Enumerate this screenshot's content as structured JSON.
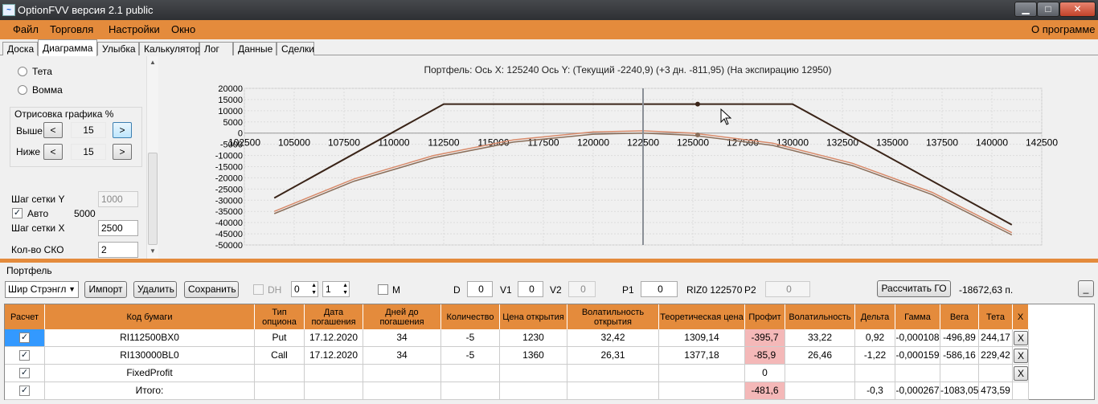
{
  "window": {
    "title": "OptionFVV версия 2.1 public",
    "minimize": "▁",
    "maximize": "□",
    "close": "✕",
    "icon": "chart-icon"
  },
  "menu": {
    "file": "Файл",
    "trading": "Торговля",
    "settings": "Настройки",
    "window": "Окно",
    "about": "О программе"
  },
  "tabs": [
    "Доска",
    "Диаграмма",
    "Улыбка",
    "Калькулятор",
    "Лог",
    "Данные",
    "Сделки"
  ],
  "left": {
    "theta": "Тета",
    "vomma": "Вомма",
    "group_title": "Отрисовка графика %",
    "above_label": "Выше",
    "above_value": "15",
    "below_label": "Ниже",
    "below_value": "15",
    "prev": "<",
    "next": ">",
    "grid_y_label": "Шаг сетки Y",
    "grid_y_value": "1000",
    "auto_label": "Авто",
    "auto_value": "5000",
    "grid_x_label": "Шаг сетки X",
    "grid_x_value": "2500",
    "sko_label": "Кол-во СКО",
    "sko_value": "2"
  },
  "chart_data": {
    "type": "line",
    "title": "Портфель: Ось X:  125240 Ось Y:   (Текущий -2240,9)   (+3 дн. -811,95)   (На экспирацию 12950)",
    "xlim": [
      102500,
      142500
    ],
    "ylim": [
      -50000,
      20000
    ],
    "x_ticks": [
      "102500",
      "105000",
      "107500",
      "110000",
      "112500",
      "115000",
      "117500",
      "120000",
      "122500",
      "125000",
      "127500",
      "130000",
      "132500",
      "135000",
      "137500",
      "140000",
      "142500"
    ],
    "y_ticks": [
      "20000",
      "15000",
      "10000",
      "5000",
      "0",
      "-5000",
      "-10000",
      "-15000",
      "-20000",
      "-25000",
      "-30000",
      "-35000",
      "-40000",
      "-45000",
      "-50000"
    ],
    "grid": true,
    "current_x": 122500,
    "cursor_x": 125240,
    "series": [
      {
        "color": "#3a2418",
        "x": [
          104000,
          112500,
          130000,
          141000
        ],
        "y": [
          -29000,
          12950,
          12950,
          -41000
        ]
      },
      {
        "color": "#d88a6a",
        "x": [
          104000,
          108000,
          112000,
          116000,
          120000,
          122500,
          125000,
          129000,
          133000,
          137000,
          141000
        ],
        "y": [
          -35000,
          -20500,
          -10000,
          -3000,
          500,
          1000,
          0,
          -4500,
          -13500,
          -26500,
          -44500
        ]
      },
      {
        "color": "#8a6e5a",
        "x": [
          104000,
          108000,
          112000,
          116000,
          120000,
          122500,
          125000,
          129000,
          133000,
          137000,
          141000
        ],
        "y": [
          -36000,
          -21500,
          -11000,
          -4000,
          -500,
          0,
          -1000,
          -5500,
          -14500,
          -27500,
          -45500
        ]
      }
    ]
  },
  "portfolio": {
    "label": "Портфель",
    "combo_value": "Шир Стрэнгл",
    "import": "Импорт",
    "delete": "Удалить",
    "save": "Сохранить",
    "dh": "DH",
    "spin1": "0",
    "spin2": "1",
    "m": "M",
    "d_label": "D",
    "d_value": "0",
    "v1_label": "V1",
    "v1_value": "0",
    "v2_label": "V2",
    "v2_value": "0",
    "p1_label": "P1",
    "p1_value": "0",
    "riz": "RIZ0 122570",
    "p2_label": "P2",
    "p2_value": "0",
    "calc_go": "Рассчитать ГО",
    "go_value": "-18672,63 п.",
    "minimize": "_"
  },
  "table": {
    "headers": [
      "Расчет",
      "Код бумаги",
      "Тип опциона",
      "Дата погашения",
      "Дней до погашения",
      "Количество",
      "Цена открытия",
      "Волатильность открытия",
      "Теоретическая цена",
      "Профит",
      "Волатильность",
      "Дельта",
      "Гамма",
      "Вега",
      "Тета",
      "X"
    ],
    "rows": [
      [
        "✓",
        "RI112500BX0",
        "Put",
        "17.12.2020",
        "34",
        "-5",
        "1230",
        "32,42",
        "1309,14",
        "-395,7",
        "33,22",
        "0,92",
        "-0,000108",
        "-496,89",
        "244,17",
        "X"
      ],
      [
        "✓",
        "RI130000BL0",
        "Call",
        "17.12.2020",
        "34",
        "-5",
        "1360",
        "26,31",
        "1377,18",
        "-85,9",
        "26,46",
        "-1,22",
        "-0,000159",
        "-586,16",
        "229,42",
        "X"
      ],
      [
        "✓",
        "FixedProfit",
        "",
        "",
        "",
        "",
        "",
        "",
        "",
        "0",
        "",
        "",
        "",
        "",
        "",
        "X"
      ],
      [
        "✓",
        "Итого:",
        "",
        "",
        "",
        "",
        "",
        "",
        "",
        "-481,6",
        "",
        "-0,3",
        "-0,000267",
        "-1083,05",
        "473,59",
        ""
      ]
    ]
  }
}
